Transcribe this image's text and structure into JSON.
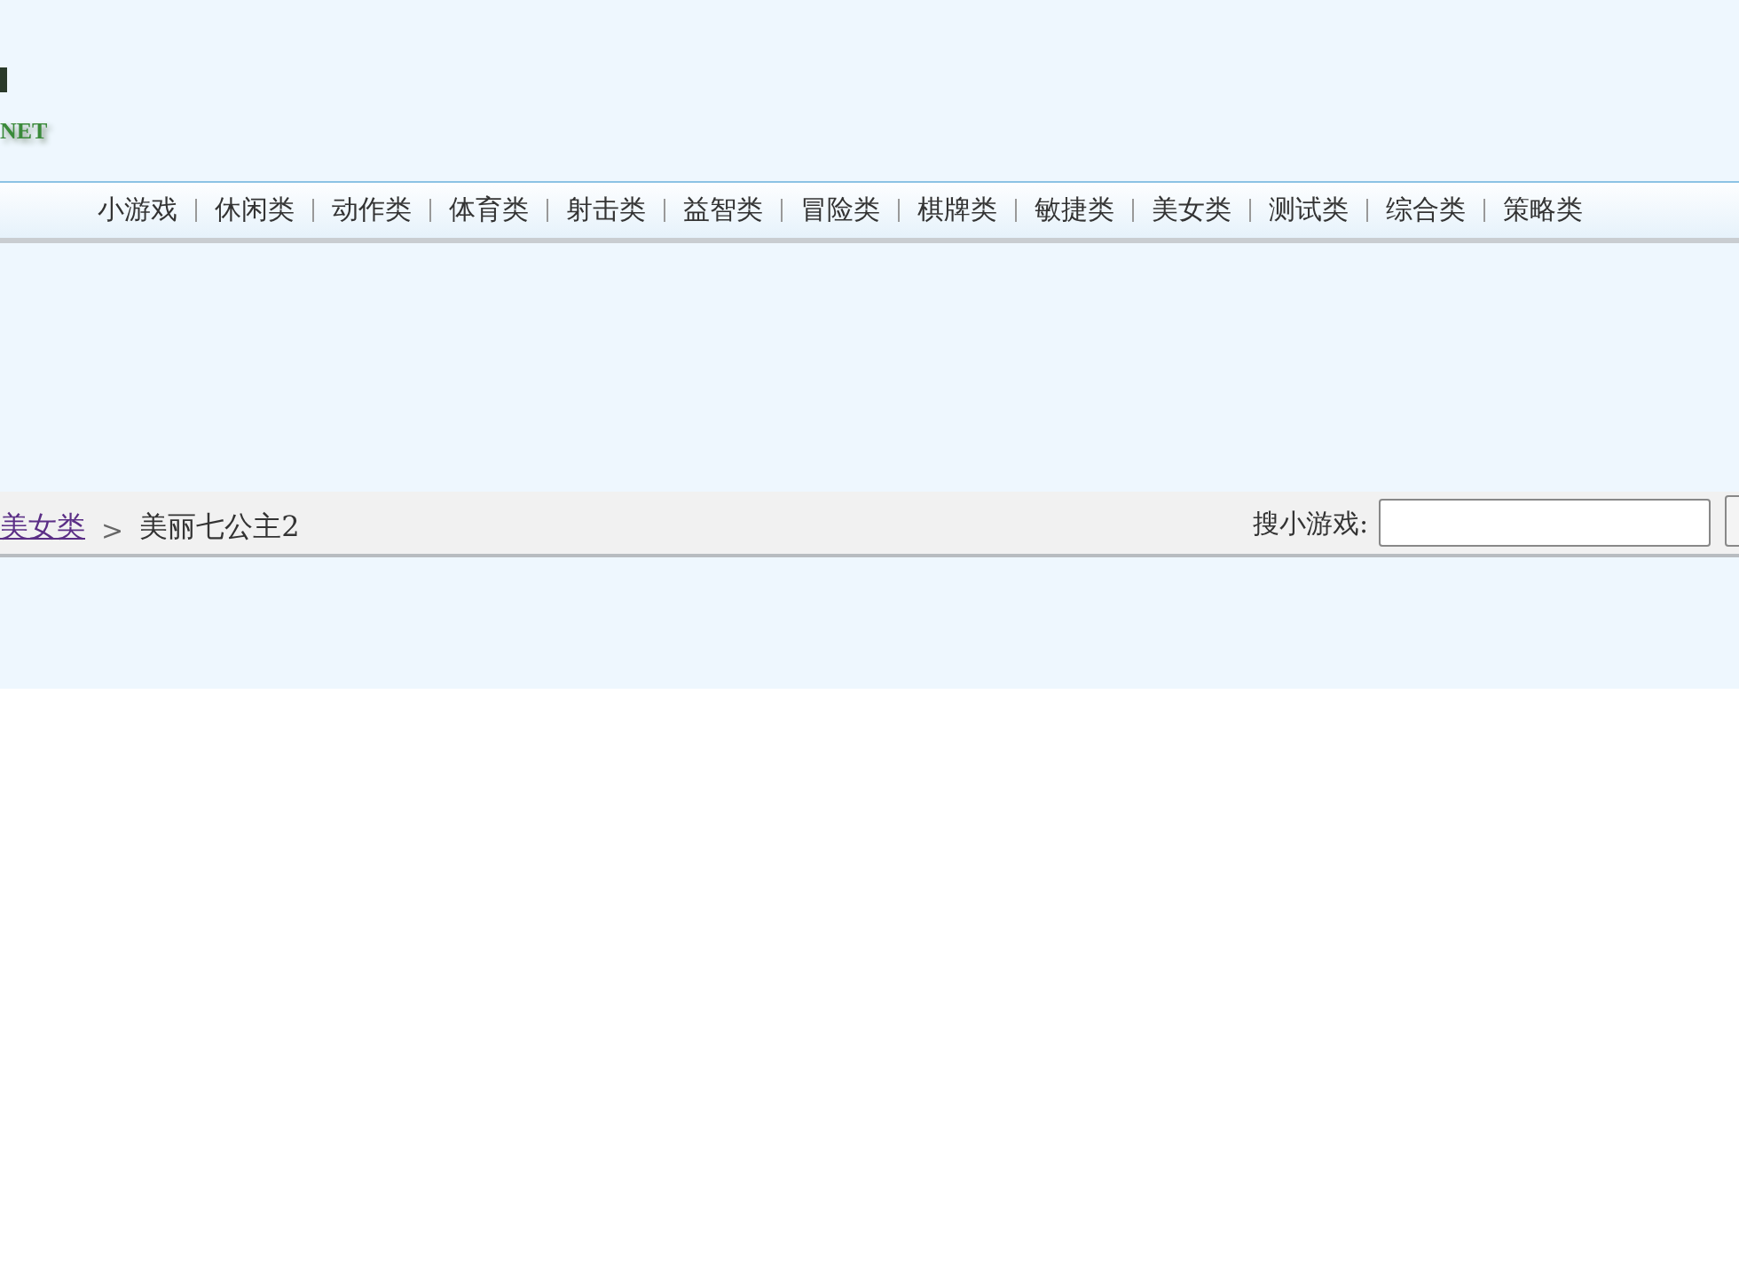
{
  "logo": {
    "text": "NET"
  },
  "nav": [
    "小游戏",
    "休闲类",
    "动作类",
    "体育类",
    "射击类",
    "益智类",
    "冒险类",
    "棋牌类",
    "敏捷类",
    "美女类",
    "测试类",
    "综合类",
    "策略类"
  ],
  "breadcrumb": {
    "link": "美女类",
    "separator": ">",
    "current": "美丽七公主2"
  },
  "search": {
    "label": "搜小游戏:"
  }
}
